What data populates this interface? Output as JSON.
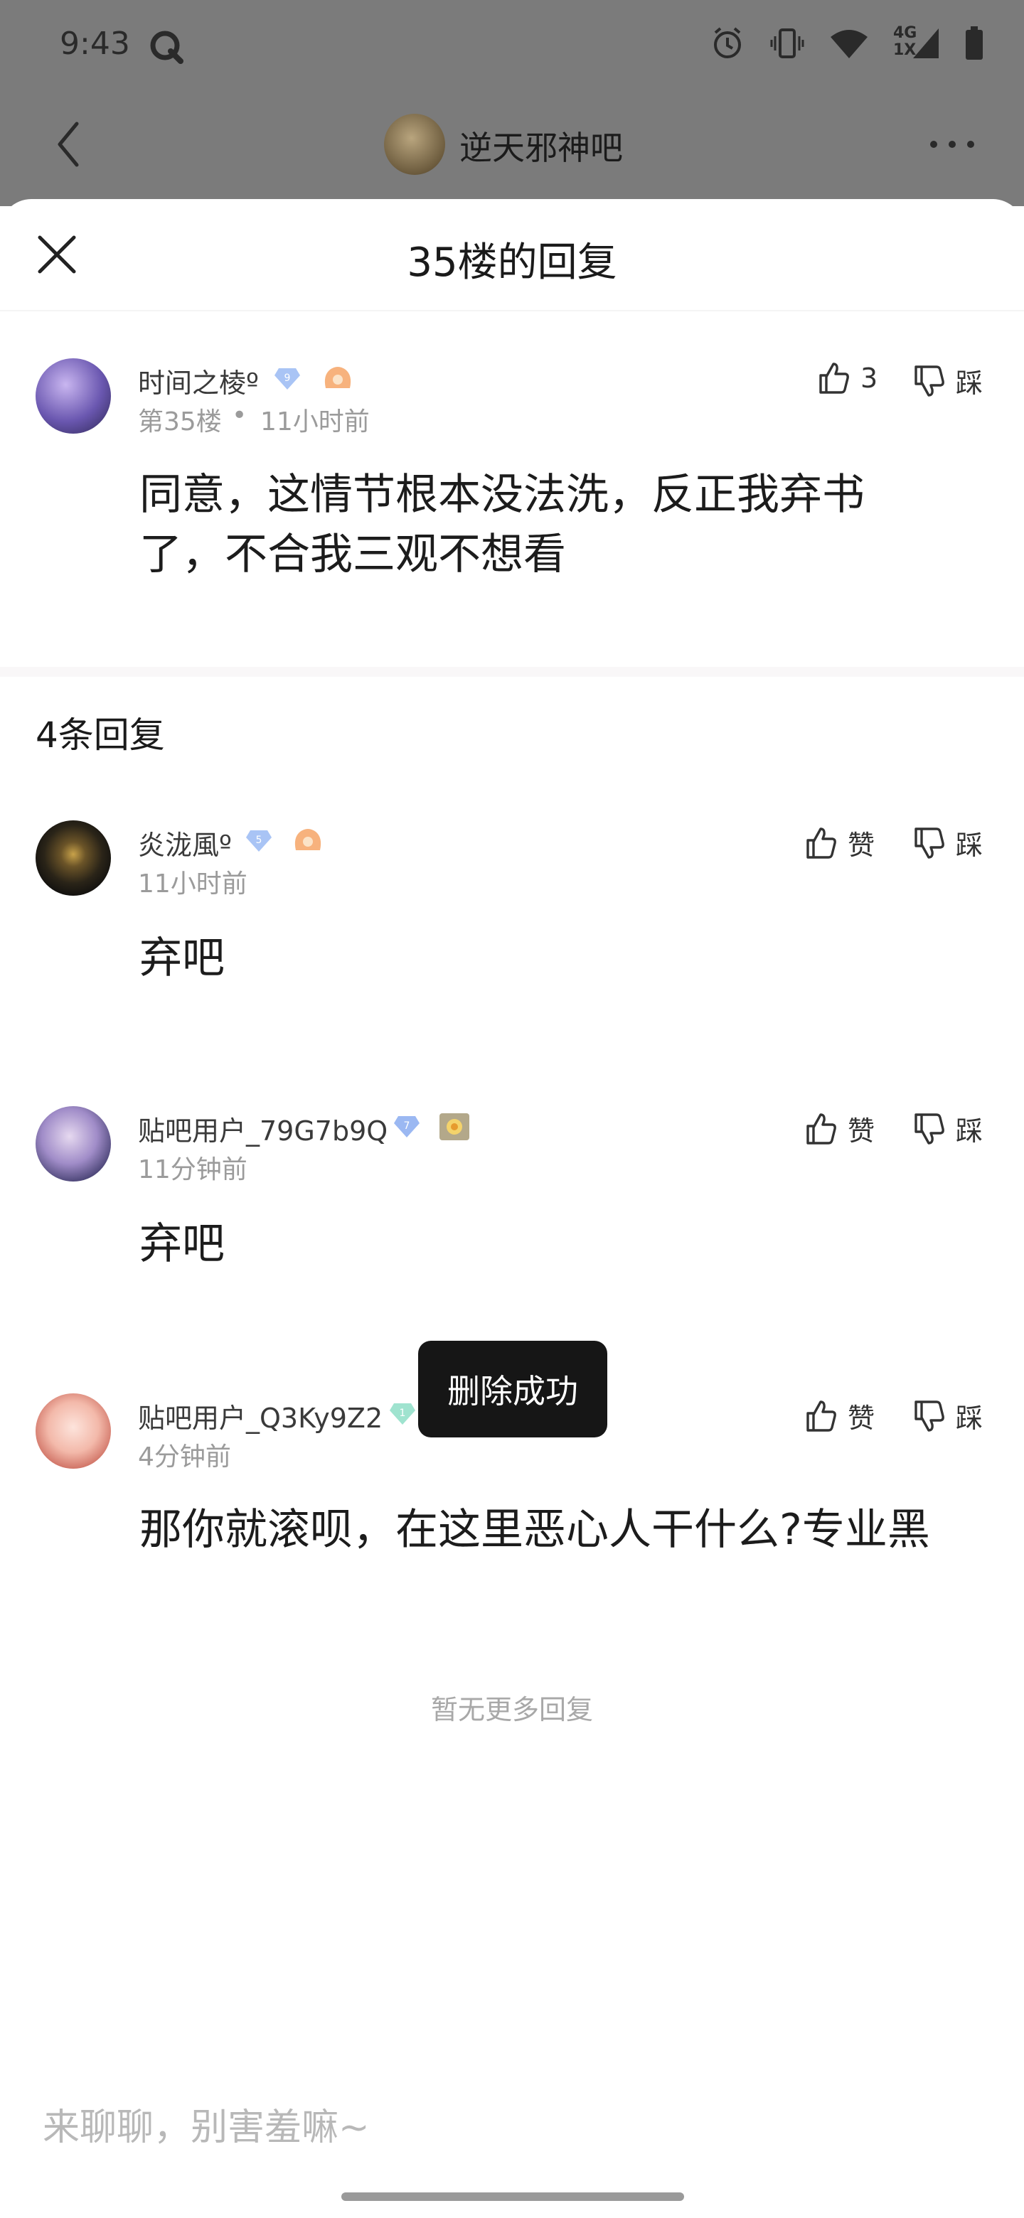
{
  "status_bar": {
    "time": "9:43",
    "network_label_top": "4G",
    "network_label_bottom": "1X"
  },
  "nav": {
    "forum_title": "逆天邪神吧"
  },
  "sheet": {
    "title": "35楼的回复"
  },
  "main_post": {
    "username": "时间之棱º",
    "level": "9",
    "floor": "第35楼",
    "dot": "•",
    "time": "11小时前",
    "content_line1": "同意，这情节根本没法洗，反正我弃书",
    "content_line2": "了，不合我三观不想看",
    "like_count": "3",
    "dislike_label": "踩"
  },
  "reply_count_label": "4条回复",
  "replies": [
    {
      "username": "炎泷風º",
      "level": "5",
      "time": "11小时前",
      "content": "弃吧",
      "like_label": "赞",
      "dislike_label": "踩"
    },
    {
      "username": "贴吧用户_79G7b9Q",
      "level": "7",
      "time": "11分钟前",
      "content": "弃吧",
      "like_label": "赞",
      "dislike_label": "踩"
    },
    {
      "username": "贴吧用户_Q3Ky9Z2",
      "level": "1",
      "time": "4分钟前",
      "content": "那你就滚呗，在这里恶心人干什么?专业黑",
      "like_label": "赞",
      "dislike_label": "踩"
    }
  ],
  "toast": "删除成功",
  "no_more_label": "暂无更多回复",
  "input": {
    "placeholder": "来聊聊，别害羞嘛~"
  },
  "colors": {
    "dim_overlay": "#7b7b7b",
    "toast_bg": "#161616",
    "meta_text": "#9b9b9b"
  }
}
